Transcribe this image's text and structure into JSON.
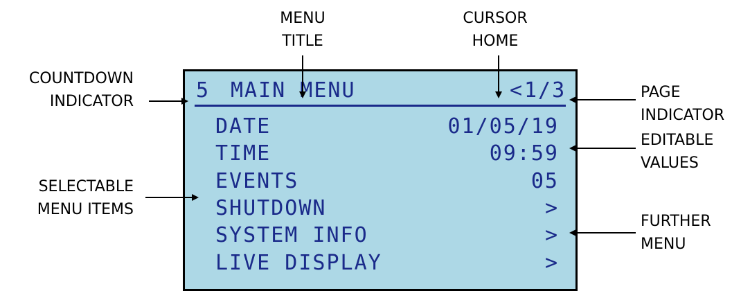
{
  "annotations": {
    "menu_title": [
      "MENU",
      "TITLE"
    ],
    "cursor_home": [
      "CURSOR",
      "HOME"
    ],
    "countdown_indicator": [
      "COUNTDOWN",
      "INDICATOR"
    ],
    "page_indicator": [
      "PAGE",
      "INDICATOR"
    ],
    "editable_values": [
      "EDITABLE",
      "VALUES"
    ],
    "selectable_menu_items": [
      "SELECTABLE",
      "MENU ITEMS"
    ],
    "further_menu": [
      "FURTHER",
      "MENU"
    ]
  },
  "lcd": {
    "countdown": "5",
    "title": "MAIN MENU",
    "cursor": "<",
    "page": "1/3",
    "items": [
      {
        "label": "DATE",
        "value": "01/05/19"
      },
      {
        "label": "TIME",
        "value": "09:59"
      },
      {
        "label": "EVENTS",
        "value": "05"
      },
      {
        "label": "SHUTDOWN",
        "value": ">"
      },
      {
        "label": "SYSTEM INFO",
        "value": ">"
      },
      {
        "label": "LIVE DISPLAY",
        "value": ">"
      }
    ]
  },
  "colors": {
    "lcd_background": "#add8e6",
    "lcd_text": "#1a2a8a"
  }
}
